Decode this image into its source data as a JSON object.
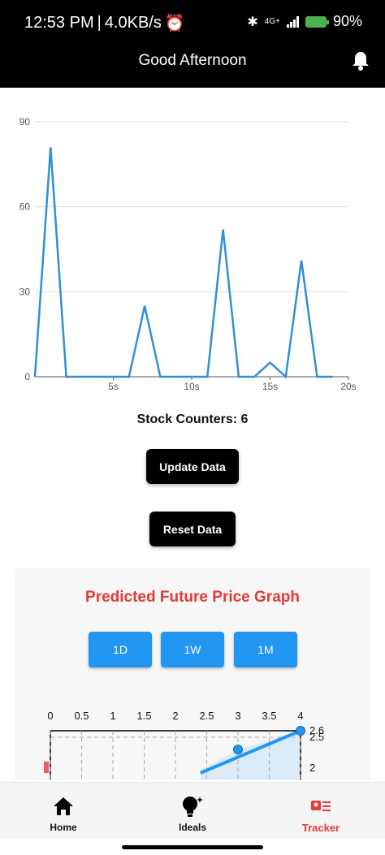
{
  "status_bar": {
    "time": "12:53 PM",
    "speed": "4.0KB/s",
    "network": "4G+",
    "battery": "90%"
  },
  "app_bar": {
    "title": "Good Afternoon"
  },
  "stock_chart": {
    "chart_data": {
      "type": "line",
      "x": [
        0,
        1,
        2,
        3,
        4,
        5,
        6,
        7,
        8,
        9,
        10,
        11,
        12,
        13,
        14,
        15,
        16,
        17,
        18,
        19
      ],
      "values": [
        0,
        81,
        0,
        0,
        0,
        0,
        0,
        25,
        0,
        0,
        0,
        0,
        52,
        0,
        0,
        5,
        0,
        41,
        0,
        0
      ],
      "x_ticks": [
        "5s",
        "10s",
        "15s",
        "20s"
      ],
      "y_ticks": [
        "0",
        "30",
        "60",
        "90"
      ],
      "ylim": [
        0,
        90
      ],
      "xlim": [
        0,
        20
      ],
      "grid": true,
      "color": "#2f8fd8"
    }
  },
  "counter": {
    "label": "Stock Counters: 6"
  },
  "buttons": {
    "update": "Update Data",
    "reset": "Reset Data"
  },
  "prediction": {
    "title": "Predicted Future Price Graph",
    "ranges": [
      "1D",
      "1W",
      "1M"
    ],
    "chart_data": {
      "type": "line",
      "x_ticks": [
        "0",
        "0.5",
        "1",
        "1.5",
        "2",
        "2.5",
        "3",
        "3.5",
        "4"
      ],
      "y_ticks": [
        "2.6",
        "2.5",
        "2"
      ],
      "points": [
        [
          3,
          2.3
        ],
        [
          4,
          2.6
        ]
      ],
      "color": "#2196f3"
    }
  },
  "bottom_nav": {
    "items": [
      {
        "label": "Home",
        "icon": "home-icon"
      },
      {
        "label": "Ideals",
        "icon": "lightbulb-icon"
      },
      {
        "label": "Tracker",
        "icon": "tracker-icon"
      }
    ],
    "active": "Tracker"
  }
}
